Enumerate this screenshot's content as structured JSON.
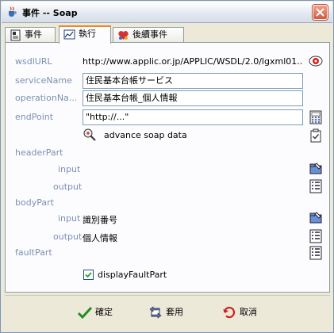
{
  "window": {
    "title": "事件 -- Soap",
    "icons": {
      "title": "java-cup-icon",
      "close": "close-x-icon"
    }
  },
  "tabs": [
    {
      "label": "事件",
      "icon": "document-icon",
      "active": false
    },
    {
      "label": "執行",
      "icon": "execute-chart-icon",
      "active": true
    },
    {
      "label": "後續事件",
      "icon": "heart-chain-icon",
      "active": false
    }
  ],
  "form": {
    "wsdlURL": {
      "label": "wsdlURL",
      "value": "http://www.applic.or.jp/APPLIC/WSDL/2.0/lgxml01..."
    },
    "serviceName": {
      "label": "serviceName",
      "value": "住民基本台帳サービス"
    },
    "operationName": {
      "label": "operationNa...",
      "value": "住民基本台帳_個人情報"
    },
    "endPoint": {
      "label": "endPoint",
      "value": "\"http://...\""
    },
    "advance": {
      "label": "advance soap data"
    },
    "headerPart": {
      "label": "headerPart"
    },
    "headerInput": {
      "label": "input",
      "value": ""
    },
    "headerOutput": {
      "label": "output",
      "value": ""
    },
    "bodyPart": {
      "label": "bodyPart"
    },
    "bodyInput": {
      "label": "input",
      "value": "識別番号"
    },
    "bodyOutput": {
      "label": "output",
      "value": "個人情報"
    },
    "faultPart": {
      "label": "faultPart"
    },
    "displayFaultPart": {
      "label": "displayFaultPart",
      "checked": true
    }
  },
  "buttons": {
    "ok": "確定",
    "apply": "套用",
    "cancel": "取消"
  },
  "colors": {
    "label": "#7d8fb0",
    "tab_highlight": "#e68b2c",
    "panel_bg": "#fcfcfe",
    "window_bg": "#ece9d8"
  }
}
